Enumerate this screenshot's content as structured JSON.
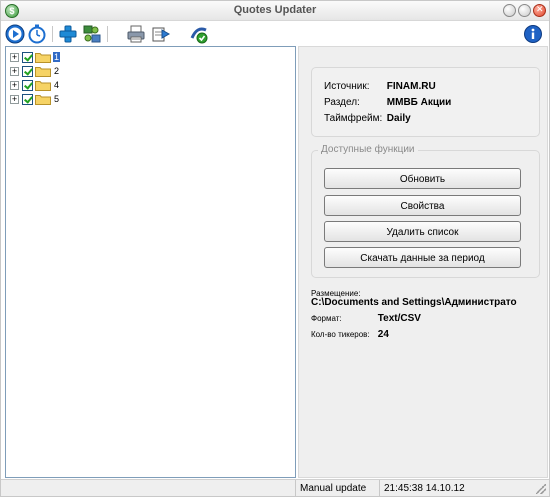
{
  "window": {
    "title": "Quotes Updater",
    "app_icon_letter": "$"
  },
  "toolbar": {
    "buttons": [
      {
        "icon": "play-icon"
      },
      {
        "icon": "timer-icon"
      },
      {
        "icon": "add-icon"
      },
      {
        "icon": "network-settings-icon"
      },
      {
        "icon": "printer-icon"
      },
      {
        "icon": "export-icon"
      },
      {
        "icon": "connect-check-icon"
      }
    ],
    "info_icon": "info-icon"
  },
  "tree": {
    "items": [
      {
        "label": "1",
        "selected": true
      },
      {
        "label": "2",
        "selected": false
      },
      {
        "label": "4",
        "selected": false
      },
      {
        "label": "5",
        "selected": false
      }
    ]
  },
  "details": {
    "source_label": "Источник:",
    "source_value": "FINAM.RU",
    "section_label": "Раздел:",
    "section_value": "ММВБ Акции",
    "timeframe_label": "Таймфрейм:",
    "timeframe_value": "Daily"
  },
  "actions": {
    "title": "Доступные функции",
    "update": "Обновить",
    "properties": "Свойства",
    "delete_list": "Удалить список",
    "download_period": "Скачать данные за период"
  },
  "output": {
    "location_label": "Размещение:",
    "location_value": "C:\\Documents and Settings\\Администрато",
    "format_label": "Формат:",
    "format_value": "Text/CSV",
    "tickers_label": "Кол-во тикеров:",
    "tickers_value": "24"
  },
  "statusbar": {
    "mode": "Manual update",
    "datetime": "21:45:38 14.10.12"
  }
}
